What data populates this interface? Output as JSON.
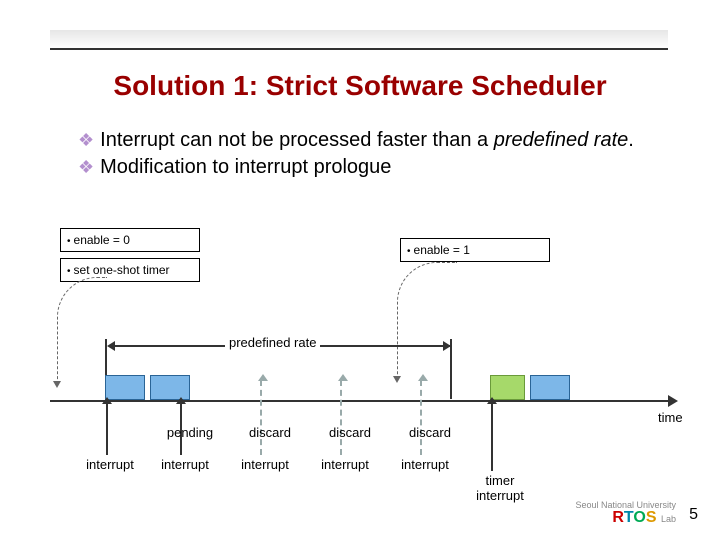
{
  "title": "Solution 1: Strict Software Scheduler",
  "bullets": {
    "b1_pre": "Interrupt can not be processed faster than a ",
    "b1_italic": "predefined rate",
    "b1_post": ".",
    "b2": "Modification to interrupt prologue"
  },
  "boxes": {
    "enable0": "enable = 0",
    "set_timer": "set one-shot timer",
    "enable1": "enable = 1"
  },
  "diagram": {
    "rate_label": "predefined rate",
    "time_label": "time",
    "pending": "pending",
    "discard": "discard",
    "interrupt": "interrupt",
    "timer_interrupt": "timer\ninterrupt"
  },
  "page_number": "5",
  "logo": {
    "affiliation": "Seoul National University",
    "name": "RTOS",
    "suffix": "Lab"
  }
}
